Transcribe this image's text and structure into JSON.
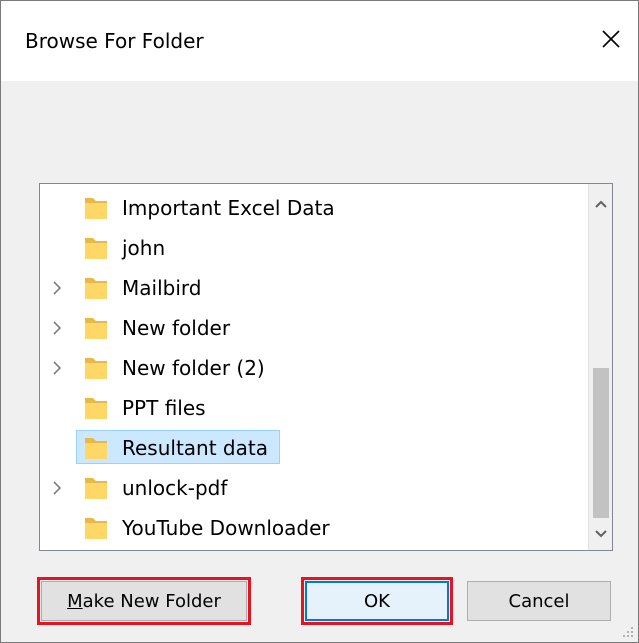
{
  "window": {
    "title": "Browse For Folder"
  },
  "tree": {
    "items": [
      {
        "label": "Important Excel Data",
        "expandable": false,
        "selected": false
      },
      {
        "label": "john",
        "expandable": false,
        "selected": false
      },
      {
        "label": "Mailbird",
        "expandable": true,
        "selected": false
      },
      {
        "label": "New folder",
        "expandable": true,
        "selected": false
      },
      {
        "label": "New folder (2)",
        "expandable": true,
        "selected": false
      },
      {
        "label": "PPT files",
        "expandable": false,
        "selected": false
      },
      {
        "label": "Resultant data",
        "expandable": false,
        "selected": true
      },
      {
        "label": "unlock-pdf",
        "expandable": true,
        "selected": false
      },
      {
        "label": "YouTube Downloader",
        "expandable": false,
        "selected": false
      }
    ]
  },
  "buttons": {
    "make_new_folder": "Make New Folder",
    "ok": "OK",
    "cancel": "Cancel"
  },
  "colors": {
    "folder": "#ffd766",
    "selection": "#cce8ff",
    "highlight_outline": "#e8131f",
    "default_button_border": "#0078d7"
  }
}
